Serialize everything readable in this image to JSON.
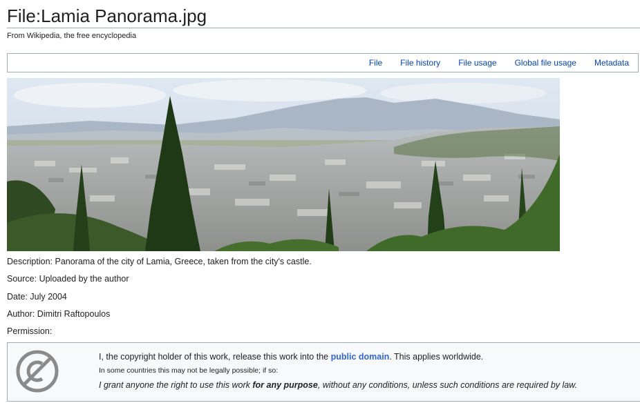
{
  "page": {
    "title": "File:Lamia Panorama.jpg",
    "tagline": "From Wikipedia, the free encyclopedia"
  },
  "tabs": [
    {
      "label": "File"
    },
    {
      "label": "File history"
    },
    {
      "label": "File usage"
    },
    {
      "label": "Global file usage"
    },
    {
      "label": "Metadata"
    }
  ],
  "image": {
    "subject": "panorama-photo"
  },
  "info": {
    "description_label": "Description:",
    "description": "Panorama of the city of Lamia, Greece, taken from the city's castle.",
    "source_label": "Source:",
    "source": "Uploaded by the author",
    "date_label": "Date:",
    "date": "July 2004",
    "author_label": "Author:",
    "author": "Dimitri Raftopoulos",
    "permission_label": "Permission:"
  },
  "license": {
    "icon": "public-domain-icon",
    "line1_before": "I, the copyright holder of this work, release this work into the",
    "line1_link": "public domain",
    "line1_after": ". This applies worldwide.",
    "line2": "In some countries this may not be legally possible; if so:",
    "line3_before": "I grant anyone the right to use this work",
    "line3_bold": "for any purpose",
    "line3_after": ", without any conditions, unless such conditions are required by law."
  },
  "colors": {
    "link": "#0645ad",
    "pd_link": "#3366cc",
    "license_bg": "#f8f9fa",
    "border": "#a2a9b1"
  }
}
